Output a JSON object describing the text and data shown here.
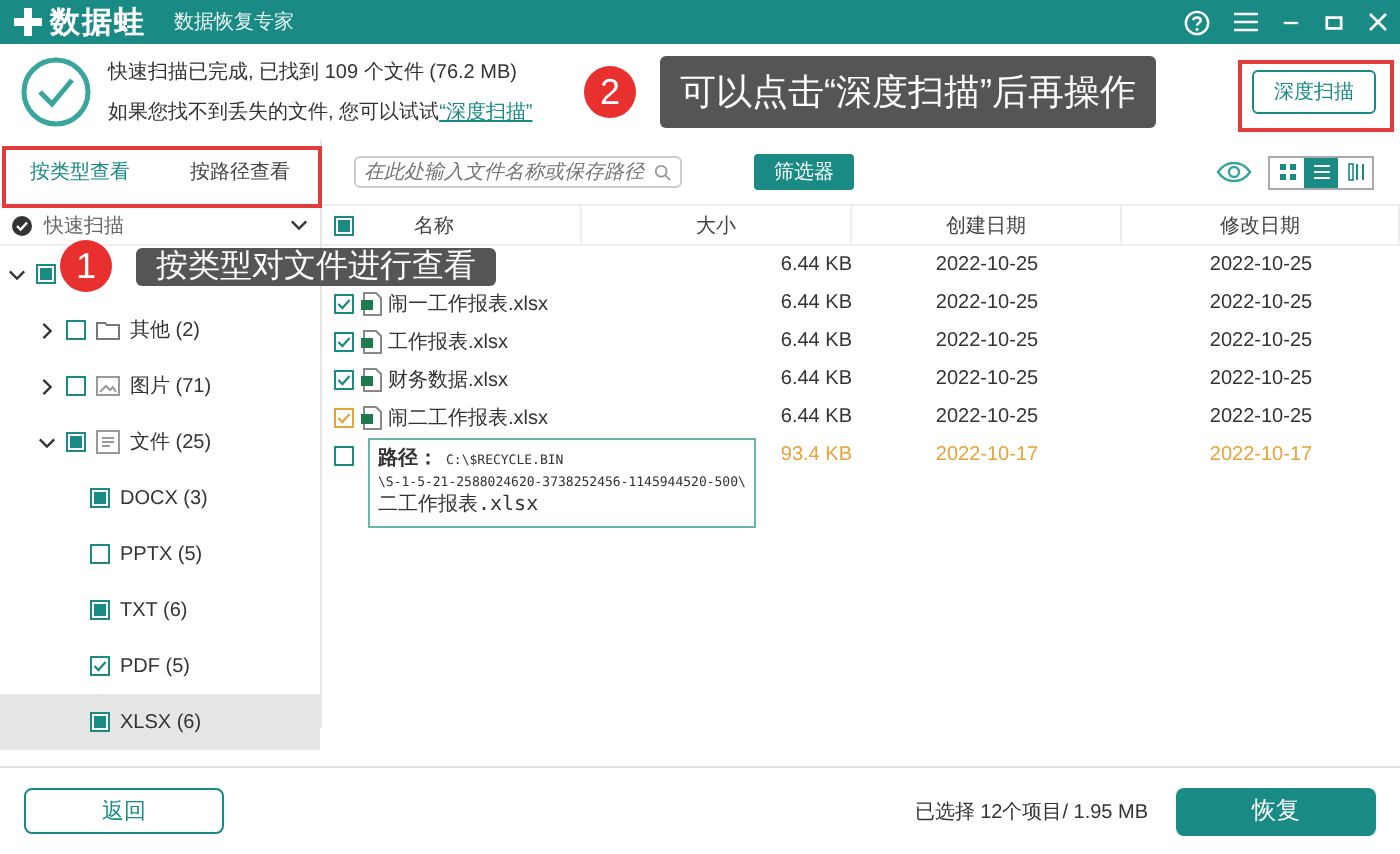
{
  "title_bar": {
    "app_name": "数据蛙",
    "subtitle": "数据恢复专家"
  },
  "scan_summary": {
    "line1": "快速扫描已完成, 已找到 109 个文件 (76.2 MB)",
    "line2_prefix": "如果您找不到丢失的文件, 您可以试试",
    "deep_scan_link": "“深度扫描”"
  },
  "deep_scan_button": "深度扫描",
  "view_tabs": [
    {
      "label": "按类型查看",
      "selected": true
    },
    {
      "label": "按路径查看",
      "selected": false
    }
  ],
  "search": {
    "placeholder": "在此处输入文件名称或保存路径"
  },
  "filter_button": "筛选器",
  "view_modes": [
    {
      "kind": "grid",
      "selected": false
    },
    {
      "kind": "list",
      "selected": true
    },
    {
      "kind": "detail",
      "selected": false
    }
  ],
  "tree": {
    "header": "快速扫描",
    "root": {
      "checked": false,
      "partial": true,
      "expanded": true,
      "children": [
        {
          "kind": "folder",
          "label": "其他 (2)",
          "checked": false,
          "partial": false,
          "expanded": false
        },
        {
          "kind": "image",
          "label": "图片 (71)",
          "checked": false,
          "partial": false,
          "expanded": false
        },
        {
          "kind": "document",
          "label": "文件 (25)",
          "checked": false,
          "partial": true,
          "expanded": true,
          "children": [
            {
              "label": "DOCX (3)",
              "checked": false,
              "partial": true,
              "selected": false
            },
            {
              "label": "PPTX (5)",
              "checked": false,
              "partial": false,
              "selected": false
            },
            {
              "label": "TXT (6)",
              "checked": false,
              "partial": true,
              "selected": false
            },
            {
              "label": "PDF (5)",
              "checked": true,
              "selected": false
            },
            {
              "label": "XLSX (6)",
              "checked": false,
              "partial": true,
              "selected": true
            }
          ]
        }
      ]
    }
  },
  "table": {
    "header": {
      "checked": false,
      "partial": true
    },
    "columns": [
      "名称",
      "大小",
      "创建日期",
      "修改日期"
    ],
    "rows": [
      {
        "size": "6.44 KB",
        "created": "2022-10-25",
        "modified": "2022-10-25",
        "highlighted": false
      },
      {
        "name": "闹一工作报表.xlsx",
        "size": "6.44 KB",
        "created": "2022-10-25",
        "modified": "2022-10-25",
        "checked": true,
        "color": "#1a8b84",
        "highlighted": false
      },
      {
        "name": "工作报表.xlsx",
        "size": "6.44 KB",
        "created": "2022-10-25",
        "modified": "2022-10-25",
        "checked": true,
        "color": "#1a8b84",
        "highlighted": false
      },
      {
        "name": "财务数据.xlsx",
        "size": "6.44 KB",
        "created": "2022-10-25",
        "modified": "2022-10-25",
        "checked": true,
        "color": "#1a8b84",
        "highlighted": false
      },
      {
        "name": "闹二工作报表.xlsx",
        "size": "6.44 KB",
        "created": "2022-10-25",
        "modified": "2022-10-25",
        "checked": true,
        "color": "#e8a23a",
        "highlighted": false
      },
      {
        "size": "93.4 KB",
        "created": "2022-10-17",
        "modified": "2022-10-17",
        "checked": false,
        "color": "#1a8b84",
        "highlighted": true
      }
    ]
  },
  "tooltip": {
    "label": "路径：",
    "lines": [
      "C:\\$RECYCLE.BIN",
      "\\S-1-5-21-2588024620-3738252456-1145944520-500\\",
      "二工作报表.xlsx"
    ]
  },
  "footer": {
    "back_button": "返回",
    "selection_info": "已选择 12个项目/ 1.95 MB",
    "recover_button": "恢复"
  },
  "callouts": [
    {
      "number": "1",
      "text": "按类型对文件进行查看"
    },
    {
      "number": "2",
      "text": "可以点击“深度扫描”后再操作"
    }
  ]
}
